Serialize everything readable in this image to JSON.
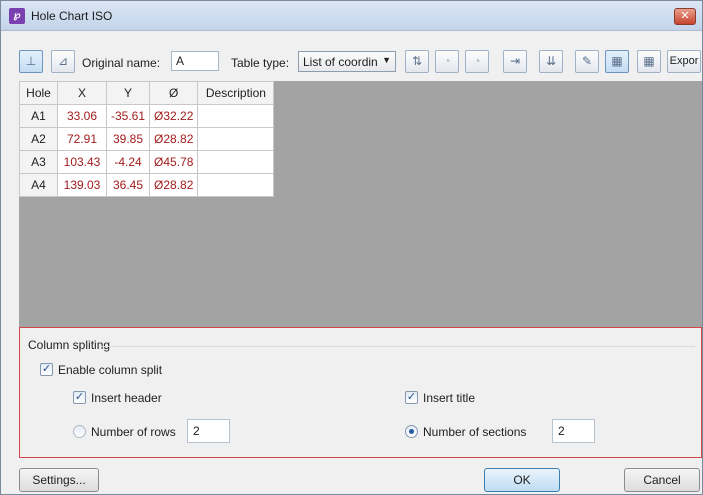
{
  "window": {
    "title": "Hole Chart ISO",
    "app_icon_glyph": "℘",
    "close_glyph": "✕"
  },
  "toolbar": {
    "original_name_label": "Original name:",
    "original_name_value": "A",
    "table_type_label": "Table type:",
    "table_type_value": "List of coordin",
    "export_label": "Expor",
    "icons": {
      "axis": "⊥",
      "origin": "⊿",
      "sort": "⇅",
      "tag_add": "◔",
      "tag": "◔",
      "merge": "⇥",
      "split": "⇊",
      "edit": "✎",
      "grid": "▦",
      "grid2": "▦"
    }
  },
  "table": {
    "columns": [
      "Hole",
      "X",
      "Y",
      "Ø",
      "Description"
    ],
    "rows": [
      {
        "hole": "A1",
        "x": "33.06",
        "y": "-35.61",
        "d": "Ø32.22",
        "desc": ""
      },
      {
        "hole": "A2",
        "x": "72.91",
        "y": "39.85",
        "d": "Ø28.82",
        "desc": ""
      },
      {
        "hole": "A3",
        "x": "103.43",
        "y": "-4.24",
        "d": "Ø45.78",
        "desc": ""
      },
      {
        "hole": "A4",
        "x": "139.03",
        "y": "36.45",
        "d": "Ø28.82",
        "desc": ""
      }
    ]
  },
  "column_splitting": {
    "title": "Column spliting",
    "enable_label": "Enable column split",
    "enable_checked": true,
    "insert_header_label": "Insert header",
    "insert_header_checked": true,
    "insert_title_label": "Insert title",
    "insert_title_checked": true,
    "rows_label": "Number of rows",
    "rows_value": "2",
    "rows_selected": false,
    "sections_label": "Number of sections",
    "sections_value": "2",
    "sections_selected": true,
    "check_glyph": "✓"
  },
  "buttons": {
    "settings": "Settings...",
    "ok": "OK",
    "cancel": "Cancel"
  },
  "colors": {
    "value_text": "#a31c1c",
    "gray_area": "#a3a3a3",
    "split_border": "#d4464b"
  }
}
